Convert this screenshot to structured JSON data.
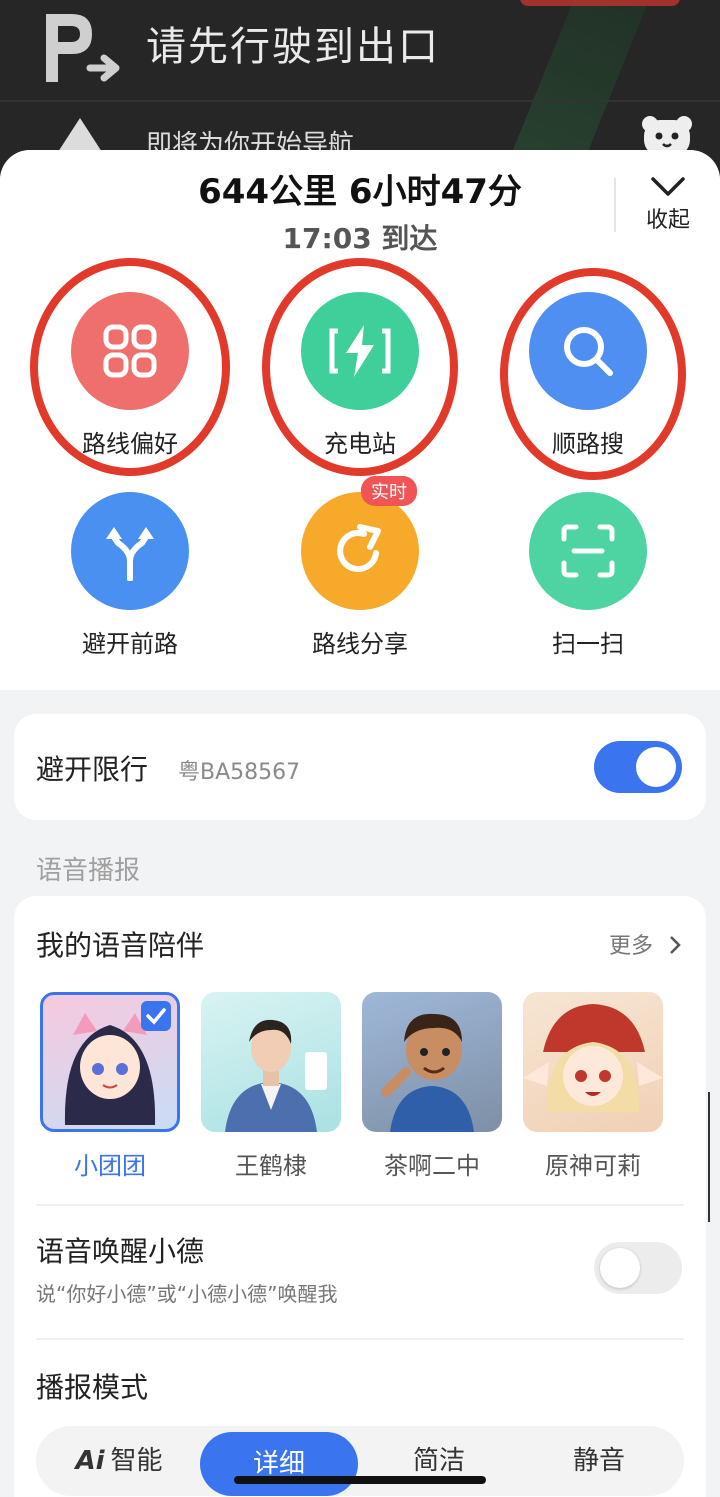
{
  "nav": {
    "instruction": "请先行驶到出口",
    "sub_text": "即将为你开始导航"
  },
  "route": {
    "distance_time": "644公里 6小时47分",
    "arrival": "17:03 到达",
    "collapse_label": "收起"
  },
  "actions": [
    {
      "label": "路线偏好",
      "icon": "grid-icon",
      "color": "#ef6f6c",
      "circled": true
    },
    {
      "label": "充电站",
      "icon": "charging-bolt-icon",
      "color": "#3fcf9b",
      "circled": true
    },
    {
      "label": "顺路搜",
      "icon": "search-icon",
      "color": "#4f8ff2",
      "circled": true
    },
    {
      "label": "避开前路",
      "icon": "split-arrows-icon",
      "color": "#4a90f0",
      "circled": false
    },
    {
      "label": "路线分享",
      "icon": "share-arrow-icon",
      "color": "#f7a92a",
      "circled": false,
      "badge": "实时"
    },
    {
      "label": "扫一扫",
      "icon": "scan-icon",
      "color": "#4ed4a2",
      "circled": false
    }
  ],
  "avoid_restriction": {
    "label": "避开限行",
    "plate": "粤BA58567",
    "enabled": true
  },
  "voice_section_label": "语音播报",
  "voice": {
    "title": "我的语音陪伴",
    "more": "更多",
    "items": [
      {
        "name": "小团团",
        "selected": true
      },
      {
        "name": "王鹤棣",
        "selected": false
      },
      {
        "name": "茶啊二中",
        "selected": false
      },
      {
        "name": "原神可莉",
        "selected": false
      }
    ],
    "wake_title": "语音唤醒小德",
    "wake_sub": "说“你好小德”或“小德小德”唤醒我",
    "wake_enabled": false,
    "mode_title": "播报模式",
    "modes": [
      {
        "label": "智能",
        "prefix": "Ai",
        "active": false
      },
      {
        "label": "详细",
        "active": true
      },
      {
        "label": "简洁",
        "active": false
      },
      {
        "label": "静音",
        "active": false
      }
    ]
  },
  "colors": {
    "accent": "#3a74ee",
    "highlight_ring": "#e23a2a"
  }
}
